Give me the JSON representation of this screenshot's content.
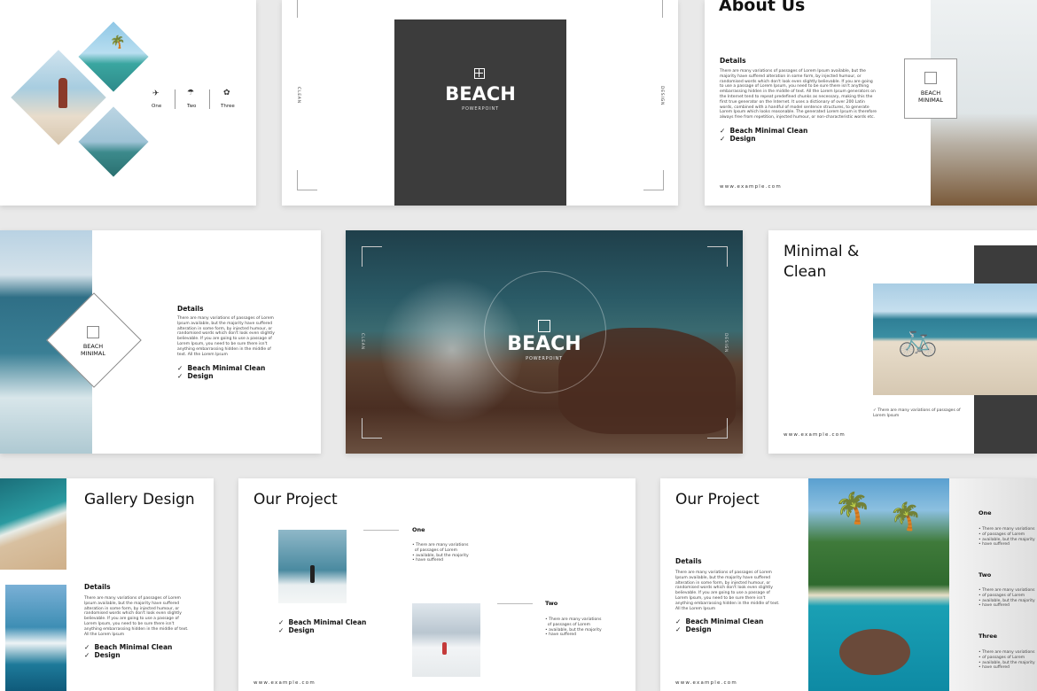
{
  "s1": {
    "icons": [
      {
        "name": "One"
      },
      {
        "name": "Two"
      },
      {
        "name": "Three"
      }
    ]
  },
  "s2": {
    "title": "BEACH",
    "subtitle": "POWERPOINT",
    "left": "CLEAN",
    "right": "DESIGN"
  },
  "s3": {
    "title": "About Us",
    "details": "Details",
    "body": "There are many variations of passages of Lorem Ipsum available, but the majority have suffered alteration in some form, by injected humour, or randomised words which don't look even slightly believable. If you are going to use a passage of Lorem Ipsum, you need to be sure there isn't anything embarrassing hidden in the middle of text. All the Lorem Ipsum generators on the Internet tend to repeat predefined chunks as necessary, making this the first true generator on the Internet. It uses a dictionary of over 200 Latin words, combined with a handful of model sentence structures, to generate Lorem Ipsum which looks reasonable. The generated Lorem Ipsum is therefore always free from repetition, injected humour, or non-characteristic words etc.",
    "check1": "Beach Minimal Clean",
    "check2": "Design",
    "badge1": "BEACH",
    "badge2": "MINIMAL",
    "url": "www.example.com"
  },
  "s4": {
    "badge1": "BEACH",
    "badge2": "MINIMAL",
    "details": "Details",
    "body": "There are many variations of passages of Lorem Ipsum available, but the majority have suffered alteration in some form, by injected humour, or randomised words which don't look even slightly believable. If you are going to use a passage of Lorem Ipsum, you need to be sure there isn't anything embarrassing hidden in the middle of text. All the Lorem Ipsum",
    "check1": "Beach Minimal Clean",
    "check2": "Design"
  },
  "s5": {
    "title": "BEACH",
    "subtitle": "POWERPOINT",
    "left": "CLEAN",
    "right": "DESIGN"
  },
  "s6": {
    "title1": "Minimal &",
    "title2": "Clean",
    "bullet": "There are many variations of passages of Lorem Ipsum",
    "url": "www.example.com"
  },
  "s7": {
    "title": "Gallery Design",
    "details": "Details",
    "body": "There are many variations of passages of Lorem Ipsum available, but the majority have suffered alteration in some form, by injected humour, or randomised words which don't look even slightly believable. If you are going to use a passage of Lorem Ipsum, you need to be sure there isn't anything embarrassing hidden in the middle of text. All the Lorem Ipsum",
    "check1": "Beach Minimal Clean",
    "check2": "Design"
  },
  "s8": {
    "title": "Our Project",
    "one": "One",
    "one_bullets": [
      "There are many variations",
      "of passages of Lorem",
      "available, but the majority",
      "have suffered"
    ],
    "two": "Two",
    "two_bullets": [
      "There are many variations",
      "of passages of Lorem",
      "available, but the majority",
      "have suffered"
    ],
    "check1": "Beach Minimal Clean",
    "check2": "Design",
    "url": "www.example.com"
  },
  "s9": {
    "title": "Our Project",
    "details": "Details",
    "body": "There are many variations of passages of Lorem Ipsum available, but the majority have suffered alteration in some form, by injected humour, or randomised words which don't look even slightly believable. If you are going to use a passage of Lorem Ipsum, you need to be sure there isn't anything embarrassing hidden in the middle of text. All the Lorem Ipsum",
    "check1": "Beach Minimal Clean",
    "check2": "Design",
    "url": "www.example.com",
    "items": [
      {
        "label": "One",
        "b": [
          "There are many variations",
          "of passages of Lorem",
          "available, but the majority",
          "have suffered"
        ]
      },
      {
        "label": "Two",
        "b": [
          "There are many variations",
          "of passages of Lorem",
          "available, but the majority",
          "have suffered"
        ]
      },
      {
        "label": "Three",
        "b": [
          "There are many variations",
          "of passages of Lorem",
          "available, but the majority",
          "have suffered"
        ]
      }
    ]
  }
}
